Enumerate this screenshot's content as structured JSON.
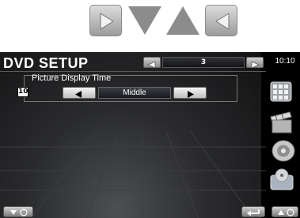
{
  "instruction_arrows": [
    "right-arrow-icon",
    "down-triangle-icon",
    "up-triangle-icon",
    "left-arrow-icon"
  ],
  "header": {
    "title": "DVD SETUP",
    "page_number": "3",
    "clock": "10:10"
  },
  "setting": {
    "label": "Picture Display Time",
    "callout_number": "10",
    "value": "Middle"
  },
  "sidebar": {
    "icons": [
      "menu-grid-icon",
      "clapperboard-icon",
      "speaker-icon",
      "disc-device-icon"
    ]
  },
  "bottom": {
    "icons": [
      "down-scroll-icon",
      "return-icon",
      "up-scroll-icon"
    ]
  },
  "colors": {
    "accent_bar": "#2c2e33",
    "callout_bg": "#ffffff"
  }
}
